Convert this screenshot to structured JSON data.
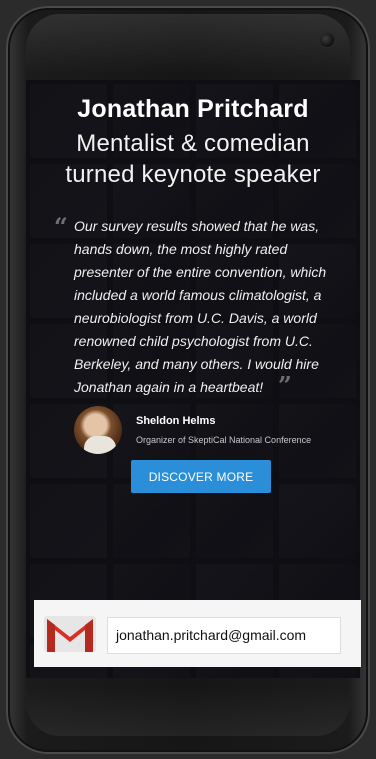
{
  "hero": {
    "title": "Jonathan Pritchard",
    "subtitle_line1": "Mentalist & comedian",
    "subtitle_line2": "turned keynote speaker"
  },
  "testimonial": {
    "quote": "Our survey results showed that he was, hands down, the most highly rated presenter of the entire convention, which included a world famous climatologist, a neurobiologist from U.C. Davis, a world renowned child psychologist from U.C. Berkeley, and many others. I would hire Jonathan again in a heartbeat!",
    "open_mark": "“",
    "close_mark": "”",
    "author_name": "Sheldon Helms",
    "author_role": "Organizer of SkeptiCal National Conference"
  },
  "cta": {
    "label": "DISCOVER MORE"
  },
  "contact": {
    "email": "jonathan.pritchard@gmail.com"
  },
  "colors": {
    "accent": "#2a8fd8",
    "gmail_red": "#d93025"
  },
  "icons": {
    "email": "gmail-icon"
  }
}
